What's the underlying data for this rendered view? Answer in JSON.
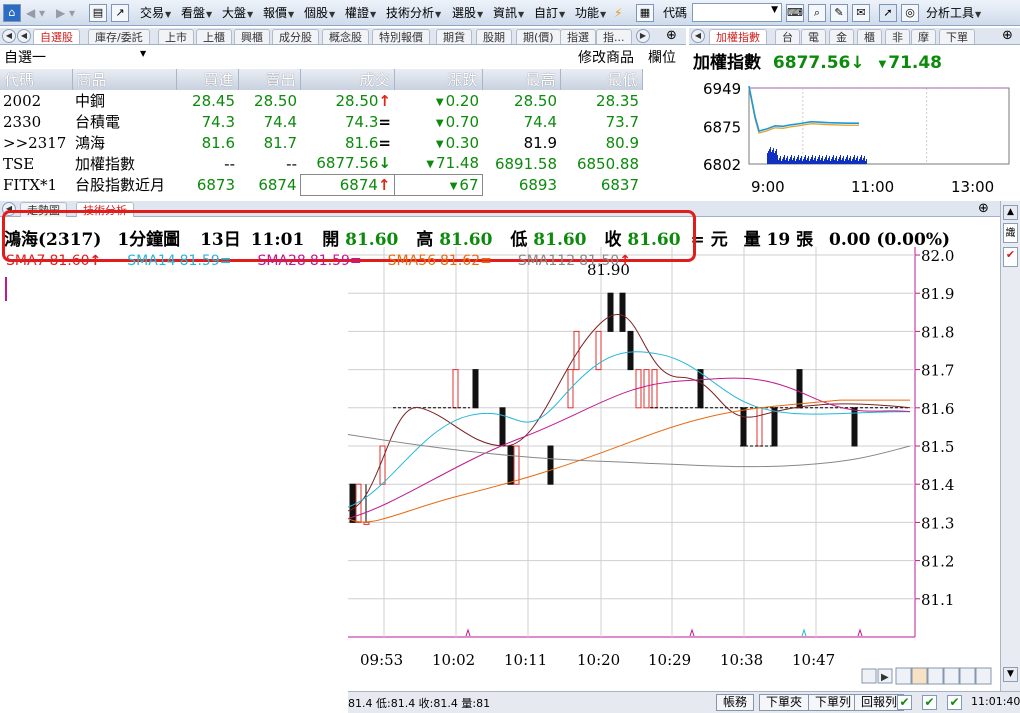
{
  "toolbar": {
    "menus": [
      "交易",
      "看盤",
      "大盤",
      "報價",
      "個股",
      "權證",
      "技術分析",
      "選股",
      "資訊",
      "自訂",
      "功能"
    ],
    "code_label": "代碼",
    "analysis_tools": "分析工具"
  },
  "quote": {
    "tabs": [
      "自選股",
      "庫存/委託",
      "上市",
      "上櫃",
      "興櫃",
      "成分股",
      "概念股",
      "特別報價",
      "期貨",
      "股期",
      "期(價)",
      "指選",
      "指..."
    ],
    "watchlist": "自選一",
    "modify_label": "修改商品",
    "column_label": "欄位",
    "columns": [
      "代碼",
      "商品",
      "買進",
      "賣出",
      "成交",
      "漲跌",
      "最高",
      "最低"
    ],
    "rows": [
      {
        "code": "2002",
        "name": "中鋼",
        "bid": "28.45",
        "ask": "28.50",
        "last": "28.50",
        "last_mark": "↑",
        "chg": "0.20",
        "high": "28.50",
        "low": "28.35",
        "last_color": "green",
        "bid_color": "green",
        "ask_color": "green",
        "high_color": "green",
        "low_color": "green"
      },
      {
        "code": "2330",
        "name": "台積電",
        "bid": "74.3",
        "ask": "74.4",
        "last": "74.3",
        "last_mark": "=",
        "chg": "0.70",
        "high": "74.4",
        "low": "73.7",
        "last_color": "green",
        "bid_color": "green",
        "ask_color": "green",
        "high_color": "green",
        "low_color": "green"
      },
      {
        "code": ">>2317",
        "name": "鴻海",
        "bid": "81.6",
        "ask": "81.7",
        "last": "81.6",
        "last_mark": "=",
        "chg": "0.30",
        "high": "81.9",
        "low": "80.9",
        "last_color": "green",
        "bid_color": "green",
        "ask_color": "green",
        "high_color": "black",
        "low_color": "green"
      },
      {
        "code": "TSE",
        "name": "加權指數",
        "bid": "--",
        "ask": "--",
        "last": "6877.56",
        "last_mark": "↓",
        "chg": "71.48",
        "high": "6891.58",
        "low": "6850.88",
        "last_color": "green",
        "bid_color": "black",
        "ask_color": "black",
        "high_color": "green",
        "low_color": "green"
      },
      {
        "code": "FITX*1",
        "name": "台股指數近月",
        "bid": "6873",
        "ask": "6874",
        "last": "6874",
        "last_mark": "↑",
        "chg": "67",
        "high": "6893",
        "low": "6837",
        "last_color": "green",
        "bid_color": "green",
        "ask_color": "green",
        "high_color": "green",
        "low_color": "green"
      }
    ]
  },
  "index": {
    "tabs": [
      "加權指數",
      "台",
      "電",
      "金",
      "櫃",
      "非",
      "摩",
      "下單"
    ],
    "name": "加權指數",
    "value": "6877.56",
    "arrow": "↓",
    "change": "71.48",
    "y_ticks": [
      "6949",
      "6875",
      "6802"
    ],
    "x_ticks": [
      "9:00",
      "11:00",
      "13:00"
    ],
    "chart_data": {
      "type": "line",
      "title": "加權指數",
      "x": [
        "9:00",
        "9:05",
        "9:10",
        "9:20",
        "9:30",
        "9:40",
        "9:50",
        "10:00",
        "10:15",
        "10:30",
        "10:45",
        "11:00"
      ],
      "series": [
        {
          "values": [
            6949,
            6890,
            6862,
            6866,
            6872,
            6871,
            6874,
            6876,
            6880,
            6878,
            6877,
            6877
          ]
        }
      ],
      "ylim": [
        6802,
        6949
      ]
    }
  },
  "chart": {
    "tabs": [
      "走勢圖",
      "技術分析"
    ],
    "header": {
      "stock": "鴻海(2317)",
      "interval": "1分鐘圖",
      "day": "13日",
      "time": "11:01",
      "open_label": "開",
      "open": "81.60",
      "high_label": "高",
      "high": "81.60",
      "low_label": "低",
      "low": "81.60",
      "close_label": "收",
      "close": "81.60",
      "eq": "=",
      "unit": "元",
      "vol_label": "量",
      "vol": "19",
      "vol_unit": "張",
      "change": "0.00 (0.00%)"
    },
    "ma_legend": [
      {
        "label": "SMA7",
        "value": "81.60",
        "mark": "↑",
        "color": "#e02020"
      },
      {
        "label": "SMA14",
        "value": "81.59",
        "mark": "=",
        "color": "#22b8d8"
      },
      {
        "label": "SMA28",
        "value": "81.59",
        "mark": "=",
        "color": "#c01890"
      },
      {
        "label": "SMA56",
        "value": "81.62",
        "mark": "=",
        "color": "#e86a10"
      },
      {
        "label": "SMA112",
        "value": "81.50",
        "mark": "↑",
        "color": "#888888"
      }
    ],
    "peak_label": "81.90",
    "y_ticks": [
      "82.0",
      "81.9",
      "81.8",
      "81.7",
      "81.6",
      "81.5",
      "81.4",
      "81.3",
      "81.2",
      "81.1"
    ],
    "x_ticks": [
      "09:53",
      "10:02",
      "10:11",
      "10:20",
      "10:29",
      "10:38",
      "10:47"
    ],
    "chart_data": {
      "type": "candlestick",
      "title": "鴻海(2317) 1分鐘圖",
      "ylim": [
        81.0,
        82.0
      ],
      "candles": [
        {
          "o": 81.4,
          "h": 81.4,
          "l": 81.3,
          "c": 81.3
        },
        {
          "o": 81.3,
          "h": 81.4,
          "l": 81.3,
          "c": 81.4
        },
        {
          "o": 81.3,
          "h": 81.4,
          "l": 81.3,
          "c": 81.3
        },
        {
          "o": 81.4,
          "h": 81.5,
          "l": 81.4,
          "c": 81.5
        },
        {
          "o": 81.6,
          "h": 81.7,
          "l": 81.6,
          "c": 81.7
        },
        {
          "o": 81.7,
          "h": 81.7,
          "l": 81.6,
          "c": 81.6
        },
        {
          "o": 81.6,
          "h": 81.6,
          "l": 81.5,
          "c": 81.5
        },
        {
          "o": 81.5,
          "h": 81.5,
          "l": 81.4,
          "c": 81.4
        },
        {
          "o": 81.4,
          "h": 81.5,
          "l": 81.4,
          "c": 81.5
        },
        {
          "o": 81.5,
          "h": 81.5,
          "l": 81.4,
          "c": 81.4
        },
        {
          "o": 81.6,
          "h": 81.7,
          "l": 81.6,
          "c": 81.7
        },
        {
          "o": 81.7,
          "h": 81.8,
          "l": 81.7,
          "c": 81.8
        },
        {
          "o": 81.7,
          "h": 81.8,
          "l": 81.7,
          "c": 81.8
        },
        {
          "o": 81.9,
          "h": 81.9,
          "l": 81.8,
          "c": 81.8
        },
        {
          "o": 81.9,
          "h": 81.9,
          "l": 81.8,
          "c": 81.8
        },
        {
          "o": 81.8,
          "h": 81.8,
          "l": 81.7,
          "c": 81.7
        },
        {
          "o": 81.6,
          "h": 81.7,
          "l": 81.6,
          "c": 81.7
        },
        {
          "o": 81.6,
          "h": 81.7,
          "l": 81.6,
          "c": 81.7
        },
        {
          "o": 81.6,
          "h": 81.7,
          "l": 81.6,
          "c": 81.7
        },
        {
          "o": 81.7,
          "h": 81.7,
          "l": 81.6,
          "c": 81.6
        },
        {
          "o": 81.6,
          "h": 81.6,
          "l": 81.5,
          "c": 81.5
        },
        {
          "o": 81.5,
          "h": 81.6,
          "l": 81.5,
          "c": 81.6
        },
        {
          "o": 81.6,
          "h": 81.6,
          "l": 81.5,
          "c": 81.5
        },
        {
          "o": 81.7,
          "h": 81.7,
          "l": 81.6,
          "c": 81.6
        },
        {
          "o": 81.6,
          "h": 81.6,
          "l": 81.5,
          "c": 81.5
        }
      ]
    }
  },
  "status": {
    "ticker": "81.4 低:81.4 收:81.4 量:81",
    "buttons": [
      "帳務",
      "下單夾",
      "下單列",
      "回報列"
    ],
    "time": "11:01:40"
  }
}
